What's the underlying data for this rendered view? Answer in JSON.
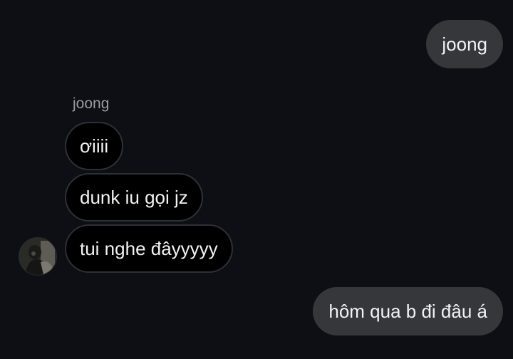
{
  "messages": [
    {
      "direction": "outgoing",
      "text": "joong"
    },
    {
      "direction": "incoming",
      "text": "ơiiii"
    },
    {
      "direction": "incoming",
      "text": "dunk iu gọi jz"
    },
    {
      "direction": "incoming",
      "text": "tui nghe đâyyyyy"
    },
    {
      "direction": "outgoing",
      "text": "hôm qua b đi đâu á"
    }
  ],
  "incoming_sender": {
    "name": "joong"
  },
  "colors": {
    "background": "#0d0f14",
    "outgoing_bubble": "#36373b",
    "incoming_bubble": "#000000",
    "incoming_border": "#2f3035",
    "text": "#f2f2f2",
    "sender_name": "#9a9ca3"
  },
  "icons": {
    "avatar": "user-photo-avatar"
  }
}
